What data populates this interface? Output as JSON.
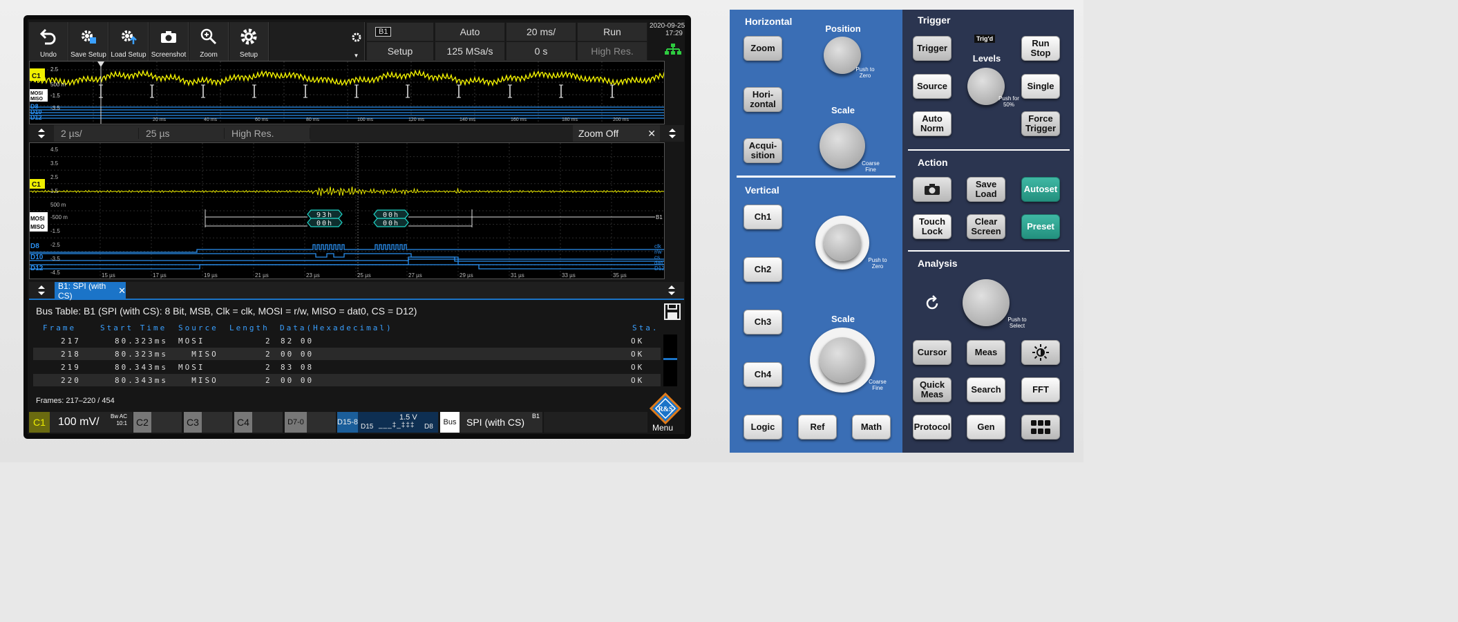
{
  "toolbar": {
    "undo": "Undo",
    "save_setup": "Save Setup",
    "load_setup": "Load Setup",
    "screenshot": "Screenshot",
    "zoom": "Zoom",
    "setup": "Setup"
  },
  "header": {
    "bus_label": "B1",
    "setup": "Setup",
    "trigger_mode": "Auto",
    "sample_rate": "125 MSa/s",
    "time_scale": "20 ms/",
    "position": "0 s",
    "run_state": "Run",
    "acq_mode": "High Res.",
    "date": "2020-09-25",
    "time": "17:29"
  },
  "overview": {
    "y_ticks": [
      "2.5",
      "500 m",
      "-1.5",
      "-3.5"
    ],
    "x_ticks": [
      "20 ms",
      "40 ms",
      "60 ms",
      "80 ms",
      "100 ms",
      "120 ms",
      "140 ms",
      "160 ms",
      "180 ms",
      "200 ms"
    ],
    "channel_labels": [
      "C1",
      "MOSI",
      "MISO",
      "D8",
      "D10",
      "D12"
    ]
  },
  "zoom_bar": {
    "scale": "2 µs/",
    "position": "25 µs",
    "acq_mode": "High Res.",
    "zoom_state": "Zoom Off"
  },
  "zoom_view": {
    "y_ticks": [
      "4.5",
      "3.5",
      "2.5",
      "1.5",
      "500 m",
      "-500 m",
      "-1.5",
      "-2.5",
      "-3.5",
      "-4.5"
    ],
    "x_ticks": [
      "15 µs",
      "17 µs",
      "19 µs",
      "21 µs",
      "23 µs",
      "25 µs",
      "27 µs",
      "29 µs",
      "31 µs",
      "33 µs",
      "35 µs"
    ],
    "channel_labels": [
      "C1",
      "MOSI",
      "MISO",
      "D8",
      "D10",
      "D12"
    ],
    "decode": {
      "mosi": [
        "93h",
        "00h"
      ],
      "miso": [
        "00h",
        "00h"
      ],
      "bus": "B1"
    },
    "digital_labels": [
      "clk",
      "r/w",
      "cs",
      "dat0",
      "D12"
    ]
  },
  "bus_table": {
    "tab_label": "B1: SPI (with CS)",
    "title": "Bus Table: B1 (SPI (with CS): 8 Bit, MSB, Clk = clk, MOSI = r/w, MISO = dat0, CS = D12)",
    "columns": [
      "Frame",
      "Start Time",
      "Source",
      "Length",
      "Data(Hexadecimal)",
      "Sta."
    ],
    "rows": [
      {
        "frame": "217",
        "start": "80.323ms",
        "source": "MOSI",
        "length": "2",
        "data": "82 00",
        "status": "OK"
      },
      {
        "frame": "218",
        "start": "80.323ms",
        "source": "  MISO",
        "length": "2",
        "data": "00 00",
        "status": "OK"
      },
      {
        "frame": "219",
        "start": "80.343ms",
        "source": "MOSI",
        "length": "2",
        "data": "83 08",
        "status": "OK"
      },
      {
        "frame": "220",
        "start": "80.343ms",
        "source": "  MISO",
        "length": "2",
        "data": "00 00",
        "status": "OK"
      }
    ],
    "frames_label": "Frames:",
    "frames_value": "217–220 / 454"
  },
  "channel_bar": {
    "c1": {
      "name": "C1",
      "scale": "100 mV/",
      "coupling": "Bw AC",
      "probe": "10:1"
    },
    "c2": "C2",
    "c3": "C3",
    "c4": "C4",
    "d7_0": "D7-0",
    "d15_8": {
      "name": "D15-8",
      "threshold": "1.5 V",
      "low": "D15",
      "high": "D8",
      "pattern": "___‡_‡‡‡"
    },
    "bus": {
      "tag": "Bus",
      "protocol": "SPI (with CS)",
      "id": "B1"
    },
    "menu": "Menu"
  },
  "colors": {
    "c1": "#f0f000",
    "digital": "#2a8ff0",
    "bus": "#1fd6c8",
    "accent": "#1b74c8",
    "teal_button": "#2aa08c"
  },
  "hw": {
    "horizontal": {
      "title": "Horizontal",
      "zoom": "Zoom",
      "horizontal": "Hori-\nzontal",
      "acquisition": "Acqui-\nsition",
      "position_label": "Position",
      "position_note": "Push to Zero",
      "scale_label": "Scale",
      "scale_note": "Coarse Fine"
    },
    "vertical": {
      "title": "Vertical",
      "ch1": "Ch1",
      "ch2": "Ch2",
      "ch3": "Ch3",
      "ch4": "Ch4",
      "position_note": "Push to Zero",
      "scale_label": "Scale",
      "scale_note": "Coarse Fine",
      "logic": "Logic",
      "ref": "Ref",
      "math": "Math"
    },
    "trigger": {
      "title": "Trigger",
      "trigger": "Trigger",
      "source": "Source",
      "auto_norm": "Auto\nNorm",
      "trigd": "Trig'd",
      "levels_label": "Levels",
      "levels_note": "Push for 50%",
      "run_stop": "Run\nStop",
      "single": "Single",
      "force": "Force\nTrigger"
    },
    "action": {
      "title": "Action",
      "save_load": "Save\nLoad",
      "autoset": "Autoset",
      "touch_lock": "Touch\nLock",
      "clear": "Clear\nScreen",
      "preset": "Preset"
    },
    "analysis": {
      "title": "Analysis",
      "knob_note": "Push to Select",
      "cursor": "Cursor",
      "meas": "Meas",
      "quick_meas": "Quick\nMeas",
      "search": "Search",
      "fft": "FFT",
      "protocol": "Protocol",
      "gen": "Gen"
    }
  }
}
